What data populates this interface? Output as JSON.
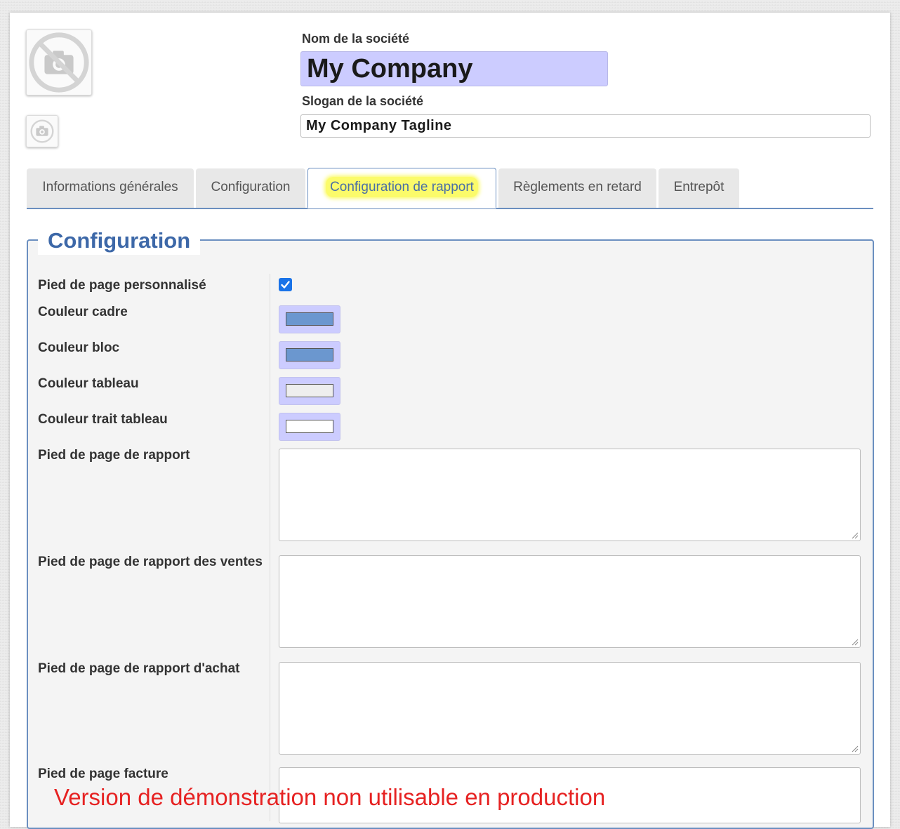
{
  "header": {
    "company_name_label": "Nom de la société",
    "company_name_value": "My Company",
    "tagline_label": "Slogan de la société",
    "tagline_value": "My Company Tagline",
    "logo_icon": "no-camera-icon",
    "logo_small_icon": "camera-icon"
  },
  "tabs": [
    {
      "label": "Informations générales",
      "active": false
    },
    {
      "label": "Configuration",
      "active": false
    },
    {
      "label": "Configuration de rapport",
      "active": true
    },
    {
      "label": "Règlements en retard",
      "active": false
    },
    {
      "label": "Entrepôt",
      "active": false
    }
  ],
  "section": {
    "title": "Configuration",
    "fields": {
      "custom_footer": {
        "label": "Pied de page personnalisé",
        "checked": true
      },
      "frame_color": {
        "label": "Couleur cadre",
        "color": "#6b97cf"
      },
      "block_color": {
        "label": "Couleur bloc",
        "color": "#6b97cf"
      },
      "table_color": {
        "label": "Couleur tableau",
        "color": "#eeeeee"
      },
      "table_line_color": {
        "label": "Couleur trait tableau",
        "color": "#ffffff"
      },
      "report_footer": {
        "label": "Pied de page de rapport",
        "value": ""
      },
      "sales_report_footer": {
        "label": "Pied de page de rapport des ventes",
        "value": ""
      },
      "purchase_report_footer": {
        "label": "Pied de page de rapport d'achat",
        "value": ""
      },
      "invoice_footer": {
        "label": "Pied de page facture",
        "value": ""
      }
    }
  },
  "watermark": "Version de démonstration non utilisable en production",
  "colors": {
    "accent": "#3d68a8",
    "tab_border": "#6b8fc0",
    "highlight": "#fbfb6a",
    "input_highlight": "#ccccff",
    "watermark": "#e62222"
  }
}
